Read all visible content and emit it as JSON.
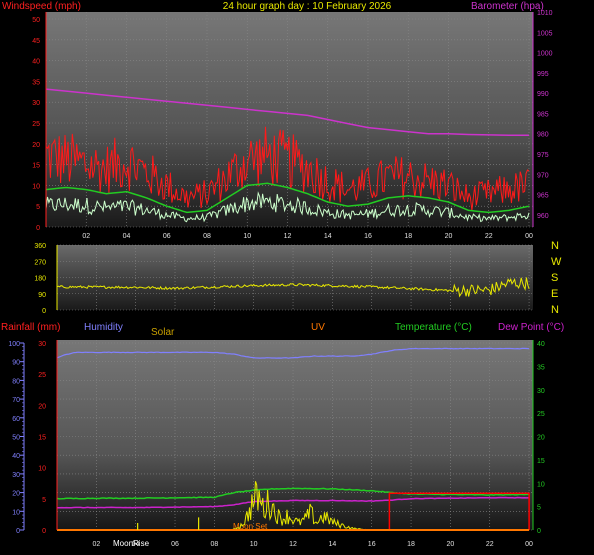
{
  "header": {
    "left_label": "Windspeed (mph)",
    "center_title": "24 hour graph day : 10 February 2026",
    "right_label": "Barometer (hpa)"
  },
  "colors": {
    "windspeed": "#ff1a1a",
    "wind_avg": "#22cc22",
    "wind_gust_light": "#ccffcc",
    "barometer": "#cc33cc",
    "direction": "#e8e800",
    "humidity": "#8080ff",
    "temperature": "#22cc22",
    "dewpoint": "#cc22cc",
    "rainfall": "#ff0000",
    "solar": "#e8e800",
    "uv": "#ff7700"
  },
  "chart_data": [
    {
      "type": "line",
      "title": "24 hour graph day : 10 February 2026",
      "x_ticks": [
        "02",
        "04",
        "06",
        "08",
        "10",
        "12",
        "14",
        "16",
        "18",
        "20",
        "22",
        "00"
      ],
      "x_hours_domain": [
        0,
        24.2
      ],
      "left_axis": {
        "label": "Windspeed (mph)",
        "ylim": [
          0,
          50
        ],
        "ticks": [
          0,
          5,
          10,
          15,
          20,
          25,
          30,
          35,
          40,
          45,
          50
        ]
      },
      "right_axis": {
        "label": "Barometer (hpa)",
        "ylim": [
          957,
          1010
        ],
        "ticks": [
          960,
          965,
          970,
          975,
          980,
          985,
          990,
          995,
          1000,
          1005,
          1010
        ]
      },
      "series": [
        {
          "name": "Windspeed (mph)",
          "axis": "left",
          "x": [
            0,
            1,
            2,
            3,
            4,
            5,
            6,
            7,
            8,
            9,
            10,
            11,
            12,
            13,
            14,
            15,
            16,
            17,
            18,
            19,
            20,
            21,
            22,
            23,
            24
          ],
          "values": [
            17,
            16,
            15,
            14,
            16,
            13,
            10,
            7,
            8,
            12,
            16,
            17,
            16,
            14,
            11,
            9,
            10,
            12,
            12,
            11,
            10,
            7,
            8,
            9,
            10
          ]
        },
        {
          "name": "Windspeed avg (mph)",
          "axis": "left",
          "x": [
            0,
            1,
            2,
            3,
            4,
            5,
            6,
            7,
            8,
            9,
            10,
            11,
            12,
            13,
            14,
            15,
            16,
            17,
            18,
            19,
            20,
            21,
            22,
            23,
            24
          ],
          "values": [
            9,
            9.5,
            9,
            8,
            8.5,
            7,
            5,
            3.5,
            4,
            7,
            10,
            10.5,
            9.5,
            8,
            6,
            5,
            5.5,
            7,
            7.5,
            7,
            6,
            4,
            3.5,
            4,
            5
          ]
        },
        {
          "name": "Barometer (hpa)",
          "axis": "right",
          "x": [
            0,
            1,
            2,
            3,
            4,
            5,
            6,
            7,
            8,
            9,
            10,
            11,
            12,
            13,
            14,
            15,
            16,
            17,
            18,
            19,
            20,
            21,
            22,
            23,
            24
          ],
          "values": [
            991,
            990.5,
            990,
            989.5,
            989,
            988.5,
            988,
            987.5,
            987,
            986.5,
            986,
            985.5,
            985,
            984.5,
            983.5,
            982.5,
            981.5,
            981,
            980.5,
            980,
            980,
            979.8,
            979.7,
            979.6,
            979.6
          ]
        }
      ]
    },
    {
      "type": "scatter",
      "title": "",
      "x_ticks": [
        "02",
        "04",
        "06",
        "08",
        "10",
        "12",
        "14",
        "16",
        "18",
        "20",
        "22",
        "00"
      ],
      "ylim": [
        0,
        360
      ],
      "y_ticks": [
        0,
        90,
        180,
        270,
        360
      ],
      "compass_labels": [
        "N",
        "W",
        "S",
        "E",
        "N"
      ],
      "series": [
        {
          "name": "Wind direction",
          "x": [
            0,
            2,
            4,
            6,
            8,
            10,
            12,
            14,
            16,
            18,
            20,
            22,
            23,
            24
          ],
          "values": [
            128,
            127,
            126,
            120,
            128,
            135,
            140,
            135,
            128,
            118,
            108,
            110,
            150,
            150
          ]
        }
      ]
    },
    {
      "type": "line",
      "title": "",
      "x_ticks": [
        "02",
        "04",
        "06",
        "08",
        "10",
        "12",
        "14",
        "16",
        "18",
        "20",
        "22",
        "00"
      ],
      "legend": [
        "Rainfall (mm)",
        "Humidity",
        "Solar",
        "UV",
        "Temperature (°C)",
        "Dew Point (°C)"
      ],
      "left_axis_rain": {
        "label": "Rainfall (mm)",
        "ylim": [
          0,
          30
        ],
        "ticks": [
          0,
          5,
          10,
          15,
          20,
          25,
          30
        ]
      },
      "left_axis_humidity": {
        "label": "Humidity",
        "ylim": [
          0,
          100
        ],
        "ticks": [
          0,
          10,
          20,
          30,
          40,
          50,
          60,
          70,
          80,
          90,
          100
        ]
      },
      "right_axis": {
        "label": "Temperature (°C)",
        "ylim": [
          0,
          40
        ],
        "ticks": [
          0,
          5,
          10,
          15,
          20,
          25,
          30,
          35,
          40
        ]
      },
      "annotations": [
        "MoonRise",
        "Moon Set"
      ],
      "series": [
        {
          "name": "Humidity",
          "axis": "humidity",
          "x": [
            0,
            0.5,
            1,
            2,
            4,
            6,
            8,
            9,
            10,
            11,
            12,
            13,
            14,
            15,
            16,
            17,
            18,
            19,
            20,
            22,
            24
          ],
          "values": [
            92,
            94,
            95,
            95,
            95,
            95,
            95,
            94,
            92,
            92,
            92,
            93,
            93,
            93,
            94,
            96,
            97,
            97,
            97,
            97,
            97
          ]
        },
        {
          "name": "Temperature (°C)",
          "axis": "right",
          "x": [
            0,
            2,
            4,
            6,
            8,
            9,
            10,
            11,
            12,
            14,
            16,
            17,
            18,
            20,
            22,
            24
          ],
          "values": [
            6.7,
            6.8,
            6.8,
            6.9,
            7,
            8,
            8.5,
            8.8,
            8.9,
            8.8,
            8.4,
            8,
            7.7,
            7.6,
            7.5,
            7.6
          ]
        },
        {
          "name": "Dew Point (°C)",
          "axis": "right",
          "x": [
            0,
            2,
            4,
            6,
            8,
            9,
            10,
            12,
            14,
            16,
            17,
            18,
            20,
            22,
            24
          ],
          "values": [
            4.8,
            4.8,
            4.8,
            4.9,
            5,
            5.4,
            6.1,
            6.3,
            6.3,
            6.2,
            6.4,
            6.7,
            6.8,
            6.9,
            6.9
          ]
        },
        {
          "name": "Rainfall (mm)",
          "axis": "rain",
          "x": [
            0,
            16.9,
            16.9,
            24,
            24
          ],
          "values": [
            0,
            0,
            5.9,
            5.9,
            0
          ]
        },
        {
          "name": "Solar",
          "axis": "right",
          "x": [
            0,
            8.9,
            9.3,
            9.6,
            9.9,
            10.2,
            10.5,
            10.8,
            11.1,
            11.4,
            11.7,
            12,
            12.3,
            12.6,
            12.9,
            13.2,
            13.5,
            13.8,
            14.1,
            14.4,
            14.7,
            15,
            15.3,
            15.7,
            16
          ],
          "values": [
            0,
            0,
            1,
            3,
            7,
            10,
            6,
            8,
            5,
            3,
            4,
            3,
            2,
            3,
            5,
            2,
            4,
            3,
            2,
            1.5,
            1,
            0.5,
            0.3,
            0.1,
            0
          ]
        },
        {
          "name": "UV",
          "axis": "right",
          "x": [
            0,
            24
          ],
          "values": [
            0,
            0
          ]
        }
      ]
    }
  ]
}
